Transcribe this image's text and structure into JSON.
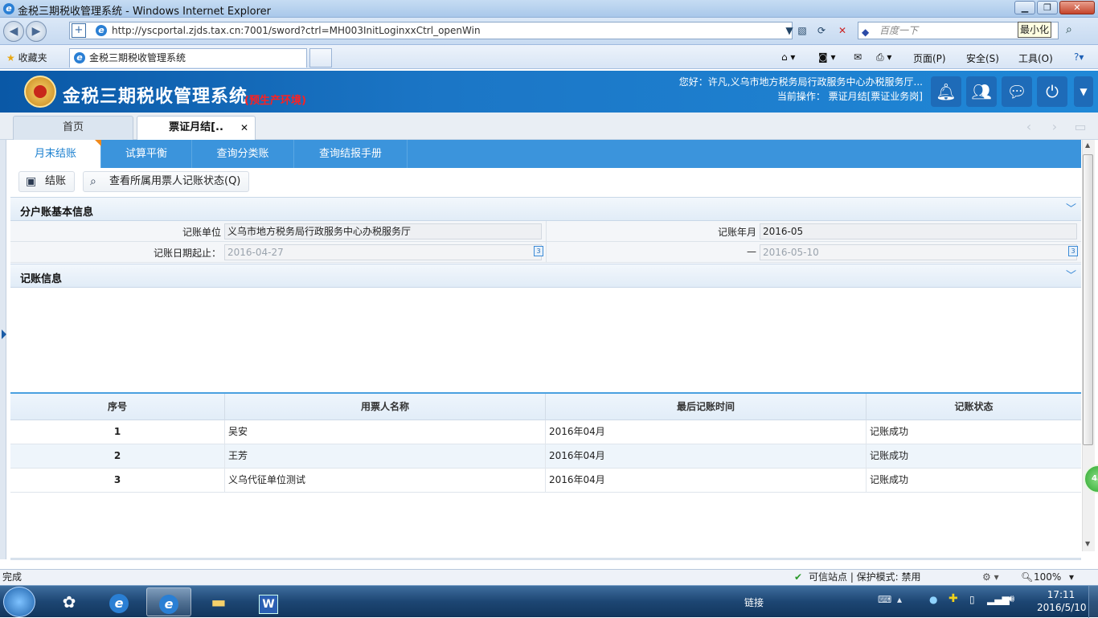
{
  "window": {
    "title": "金税三期税收管理系统 - Windows Internet Explorer",
    "min_tooltip": "最小化"
  },
  "browser": {
    "url": "http://yscportal.zjds.tax.cn:7001/sword?ctrl=MH003InitLoginxxCtrl_openWin",
    "search_placeholder": "百度一下",
    "favorites_label": "收藏夹",
    "tab_title": "金税三期税收管理系统",
    "menu": {
      "page": "页面(P)",
      "safety": "安全(S)",
      "tools": "工具(O)"
    }
  },
  "app": {
    "name": "金税三期税收管理系统",
    "env": "(预生产环境)",
    "greeting": "您好：许凡,义乌市地方税务局行政服务中心办税服务厅...",
    "current_op": "当前操作： 票证月结[票证业务岗]"
  },
  "page_tabs": {
    "home": "首页",
    "active": "票证月结[..",
    "close": "✕"
  },
  "sub_tabs": [
    "月末结账",
    "试算平衡",
    "查询分类账",
    "查询结报手册"
  ],
  "toolbar": {
    "settle": "结账",
    "query_status": "查看所属用票人记账状态(Q)"
  },
  "basic_info": {
    "title": "分户账基本信息",
    "unit_label": "记账单位",
    "unit_value": "义乌市地方税务局行政服务中心办税服务厅",
    "month_label": "记账年月",
    "month_value": "2016-05",
    "date_label": "记账日期起止：",
    "date_from": "2016-04-27",
    "date_sep": "—",
    "date_to": "2016-05-10"
  },
  "record_info": {
    "title": "记账信息"
  },
  "grid": {
    "headers": [
      "序号",
      "用票人名称",
      "最后记账时间",
      "记账状态"
    ],
    "rows": [
      [
        "1",
        "吴安",
        "2016年04月",
        "记账成功"
      ],
      [
        "2",
        "王芳",
        "2016年04月",
        "记账成功"
      ],
      [
        "3",
        "义乌代征单位测试",
        "2016年04月",
        "记账成功"
      ]
    ]
  },
  "float_badge": "45",
  "status": {
    "left": "完成",
    "zone": "可信站点 | 保护模式: 禁用",
    "zoom": "100%"
  },
  "taskbar": {
    "links": "链接",
    "time": "17:11",
    "date": "2016/5/10"
  }
}
